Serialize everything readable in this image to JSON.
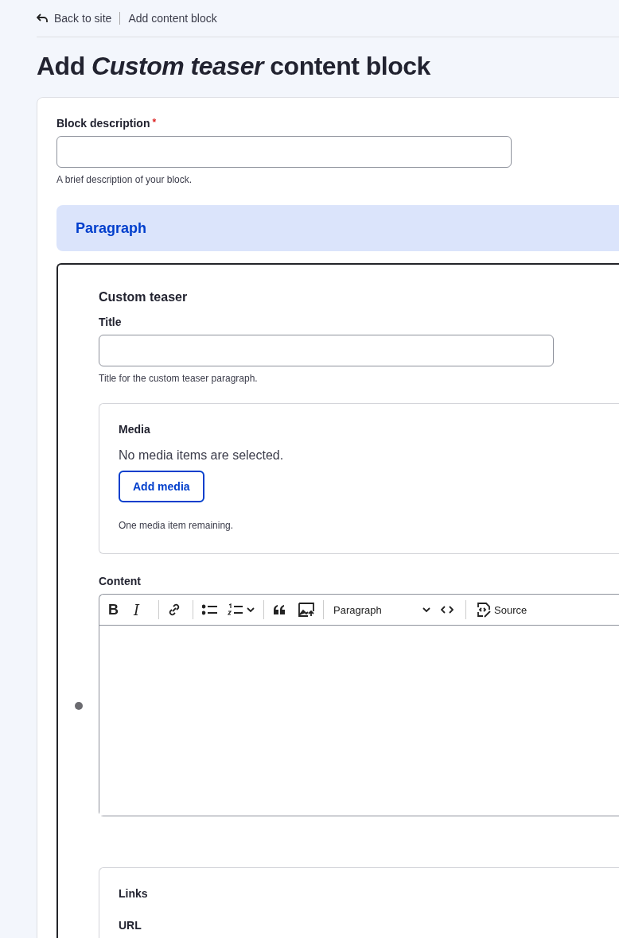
{
  "breadcrumb": {
    "back": "Back to site",
    "current": "Add content block"
  },
  "page_title": "Add *Custom teaser* content block",
  "block_description": {
    "label": "Block description",
    "required_marker": "*",
    "help": "A brief description of your block."
  },
  "paragraph_header": "Paragraph",
  "custom_teaser": {
    "heading": "Custom teaser",
    "title_field": {
      "label": "Title",
      "help": "Title for the custom teaser paragraph."
    },
    "media": {
      "legend": "Media",
      "empty_text": "No media items are selected.",
      "button": "Add media",
      "help": "One media item remaining."
    },
    "content": {
      "label": "Content",
      "toolbar": [
        {
          "kind": "text-bold",
          "label": "B"
        },
        {
          "kind": "text-italic",
          "label": "I"
        },
        {
          "kind": "separator"
        },
        {
          "kind": "link"
        },
        {
          "kind": "separator"
        },
        {
          "kind": "bullet-list"
        },
        {
          "kind": "numbered-list"
        },
        {
          "kind": "separator"
        },
        {
          "kind": "quote"
        },
        {
          "kind": "image"
        },
        {
          "kind": "separator"
        },
        {
          "kind": "dropdown",
          "label": "Paragraph"
        },
        {
          "kind": "code"
        },
        {
          "kind": "separator"
        },
        {
          "kind": "source",
          "label": "Source"
        }
      ]
    },
    "links": {
      "legend": "Links",
      "url_label": "URL"
    }
  }
}
